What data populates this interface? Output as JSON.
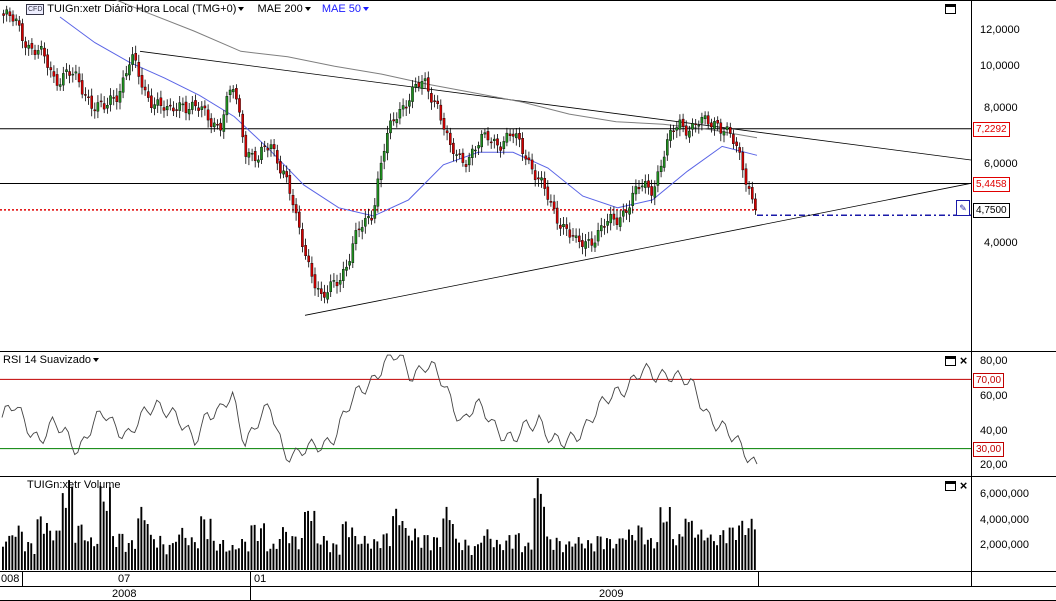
{
  "price_panel": {
    "symbol_icon": "CFD",
    "title": "TUIGn:xetr Diário Hora Local (TMG+0)",
    "indicator_1": "MAE 200",
    "indicator_2": "MAE 50",
    "axis_ticks": [
      "12,0000",
      "10,0000",
      "8,0000",
      "6,0000",
      "4,0000"
    ],
    "level_tags": [
      "7,2292",
      "5,4458"
    ],
    "current_price": "4,7500",
    "colors": {
      "ma200": "#7f7f7f",
      "ma50": "#5a64e6",
      "up": "#1e8c1e",
      "down": "#d00000",
      "level_tag": "#e00000",
      "current": "#1a1aa8"
    }
  },
  "rsi_panel": {
    "title": "RSI 14 Suavizado",
    "axis_ticks": [
      "80,00",
      "60,00",
      "40,00",
      "20,00"
    ],
    "level_tags": [
      "70,00",
      "30,00"
    ],
    "colors": {
      "upper": "#c00000",
      "lower": "#008000"
    }
  },
  "volume_panel": {
    "title": "TUIGn:xetr Volume",
    "axis_ticks": [
      "6,000,000",
      "4,000,000",
      "2,000,000"
    ]
  },
  "x_axis": {
    "top_labels": [
      "008",
      "07",
      "01"
    ],
    "bottom_labels": [
      "2008",
      "2009"
    ]
  },
  "chart_data": [
    {
      "type": "candlestick",
      "title": "TUIGn:xetr Diário Hora Local (TMG+0)",
      "ylim": [
        2.9,
        13.3
      ],
      "log_scale": true,
      "series": [
        {
          "name": "TUIGn:xetr",
          "close_path": [
            13.0,
            12.4,
            11.2,
            10.5,
            9.4,
            9.7,
            9.0,
            8.3,
            7.9,
            8.8,
            10.5,
            8.7,
            8.4,
            7.7,
            8.4,
            8.0,
            7.7,
            7.4,
            8.9,
            6.6,
            6.1,
            6.7,
            5.8,
            4.4,
            3.6,
            2.9,
            3.3,
            3.6,
            4.3,
            4.8,
            6.7,
            8.0,
            8.7,
            9.1,
            8.4,
            6.4,
            6.2,
            6.5,
            6.9,
            6.8,
            6.9,
            6.4,
            5.5,
            4.8,
            4.4,
            3.9,
            4.1,
            4.3,
            4.5,
            4.9,
            5.3,
            5.4,
            6.5,
            7.5,
            7.3,
            7.4,
            7.6,
            6.9,
            6.0,
            4.75
          ]
        },
        {
          "name": "MAE 200",
          "values_sampled": [
            14.6,
            13.2,
            12.0,
            10.8,
            10.5,
            10.0,
            9.6,
            9.1,
            8.7,
            8.3,
            7.8,
            7.5,
            7.4,
            7.2,
            6.9
          ]
        },
        {
          "name": "MAE 50",
          "values_sampled": [
            12.9,
            11.3,
            10.2,
            9.4,
            8.6,
            7.7,
            6.5,
            5.4,
            4.8,
            4.6,
            5.0,
            6.0,
            6.4,
            6.4,
            5.9,
            5.1,
            4.8,
            5.0,
            5.8,
            6.6,
            6.3
          ]
        }
      ],
      "annotations": {
        "horizontal_levels": [
          7.2292,
          5.4458
        ],
        "current_price": 4.75
      }
    },
    {
      "type": "line",
      "title": "RSI 14 Suavizado",
      "ylim": [
        15,
        85
      ],
      "reference_lines": [
        70,
        30
      ],
      "series": [
        {
          "name": "RSI 14 Suavizado",
          "values": [
            48,
            53,
            44,
            36,
            42,
            39,
            31,
            41,
            50,
            44,
            37,
            47,
            58,
            53,
            42,
            35,
            52,
            49,
            60,
            36,
            45,
            52,
            30,
            27,
            28,
            33,
            39,
            51,
            64,
            72,
            79,
            83,
            74,
            78,
            72,
            61,
            46,
            53,
            49,
            41,
            33,
            42,
            49,
            34,
            31,
            40,
            48,
            54,
            63,
            69,
            73,
            71,
            76,
            70,
            64,
            53,
            44,
            35,
            30,
            22
          ]
        }
      ]
    },
    {
      "type": "bar",
      "title": "TUIGn:xetr Volume",
      "ylim": [
        0,
        7000000
      ],
      "series": [
        {
          "name": "TUIGn:xetr Volume",
          "values": [
            2600000,
            3400000,
            2200000,
            4200000,
            3000000,
            7000000,
            3600000,
            2500000,
            6400000,
            2900000,
            2300000,
            4800000,
            2700000,
            2100000,
            3200000,
            2500000,
            4200000,
            2300000,
            1900000,
            2400000,
            3600000,
            2000000,
            3300000,
            2700000,
            4500000,
            2600000,
            2100000,
            3800000,
            2600000,
            2400000,
            2900000,
            4700000,
            3200000,
            2800000,
            2500000,
            4800000,
            2400000,
            2000000,
            3100000,
            2300000,
            2900000,
            2100000,
            7000000,
            2600000,
            2200000,
            2500000,
            2300000,
            2700000,
            2400000,
            3100000,
            3500000,
            2500000,
            4800000,
            2800000,
            3900000,
            3100000,
            2700000,
            3400000,
            3800000,
            3900000
          ]
        }
      ]
    }
  ]
}
